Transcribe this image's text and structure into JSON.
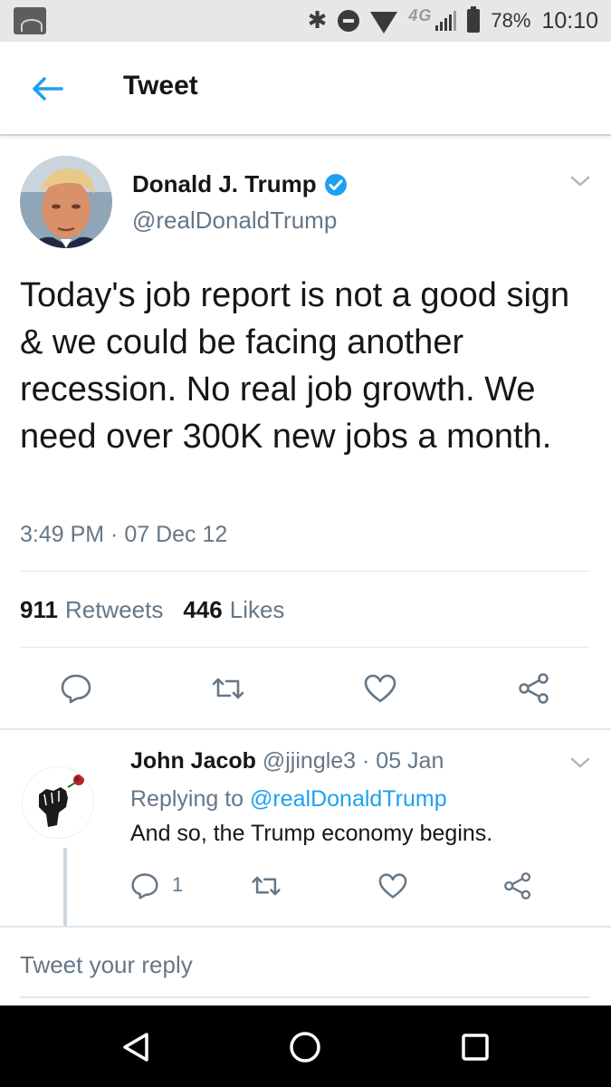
{
  "status_bar": {
    "battery": "78%",
    "time": "10:10",
    "network": "4G",
    "icons": [
      "siriusxm-app-icon",
      "bluetooth-icon",
      "do-not-disturb-icon",
      "wifi-icon",
      "signal-icon",
      "battery-icon"
    ]
  },
  "header": {
    "title": "Tweet",
    "back_icon": "arrow-left-icon"
  },
  "tweet": {
    "author_name": "Donald J. Trump",
    "verified": true,
    "handle": "@realDonaldTrump",
    "text": "Today's job report is not a good sign & we could be facing another recession. No real job growth. We need over 300K new jobs a month.",
    "timestamp": "3:49 PM · 07 Dec 12",
    "retweets_count": "911",
    "retweets_label": "Retweets",
    "likes_count": "446",
    "likes_label": "Likes",
    "actions": [
      "reply-icon",
      "retweet-icon",
      "like-icon",
      "share-icon"
    ]
  },
  "reply": {
    "author_name": "John Jacob",
    "meta": "@jjingle3 · 05 Jan",
    "replying_prefix": "Replying to",
    "replying_to": "@realDonaldTrump",
    "text": "And so, the Trump economy begins.",
    "reply_count": "1"
  },
  "compose": {
    "placeholder": "Tweet your reply"
  },
  "colors": {
    "accent": "#1da1f2",
    "secondary_text": "#657786",
    "primary_text": "#14171a"
  }
}
